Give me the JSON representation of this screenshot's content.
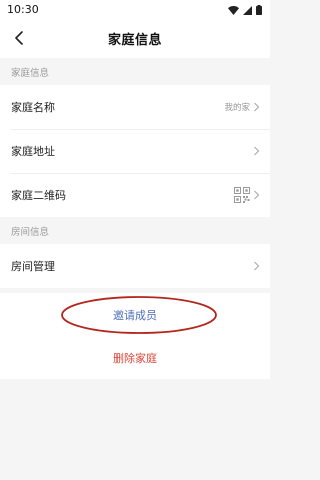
{
  "status_bar": {
    "time": "10:30"
  },
  "nav": {
    "title": "家庭信息"
  },
  "sections": {
    "family_info_header": "家庭信息",
    "room_info_header": "房间信息"
  },
  "rows": {
    "family_name": {
      "label": "家庭名称",
      "value": "我的家"
    },
    "family_address": {
      "label": "家庭地址"
    },
    "family_qrcode": {
      "label": "家庭二维码"
    },
    "room_management": {
      "label": "房间管理"
    }
  },
  "actions": {
    "invite_label": "邀请成员",
    "delete_label": "删除家庭"
  },
  "colors": {
    "invite": "#4f6fb8",
    "delete": "#d9463a",
    "annotation_ellipse": "#b3261e"
  }
}
